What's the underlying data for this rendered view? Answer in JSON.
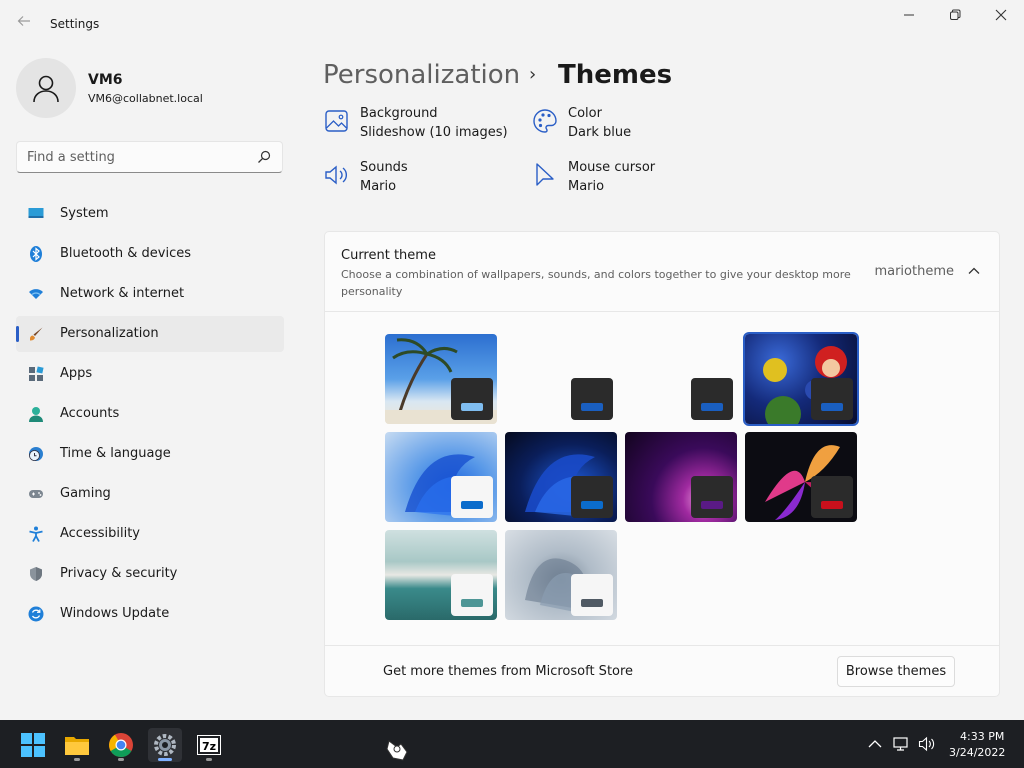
{
  "window": {
    "title": "Settings",
    "back_icon": "arrow-left-icon",
    "minimize_glyph": "—",
    "maximize_glyph": "❐",
    "close_glyph": "✕"
  },
  "profile": {
    "name": "VM6",
    "email": "VM6@collabnet.local"
  },
  "search": {
    "placeholder": "Find a setting"
  },
  "sidebar": {
    "items": [
      {
        "label": "System",
        "icon": "display-icon",
        "active": false
      },
      {
        "label": "Bluetooth & devices",
        "icon": "bluetooth-icon",
        "active": false
      },
      {
        "label": "Network & internet",
        "icon": "wifi-icon",
        "active": false
      },
      {
        "label": "Personalization",
        "icon": "brush-icon",
        "active": true
      },
      {
        "label": "Apps",
        "icon": "apps-icon",
        "active": false
      },
      {
        "label": "Accounts",
        "icon": "person-icon",
        "active": false
      },
      {
        "label": "Time & language",
        "icon": "globe-clock-icon",
        "active": false
      },
      {
        "label": "Gaming",
        "icon": "gamepad-icon",
        "active": false
      },
      {
        "label": "Accessibility",
        "icon": "accessibility-icon",
        "active": false
      },
      {
        "label": "Privacy & security",
        "icon": "shield-icon",
        "active": false
      },
      {
        "label": "Windows Update",
        "icon": "update-icon",
        "active": false
      }
    ]
  },
  "breadcrumb": {
    "parent": "Personalization",
    "separator": "›",
    "current": "Themes"
  },
  "properties": [
    {
      "title": "Background",
      "value": "Slideshow (10 images)",
      "icon": "image-icon"
    },
    {
      "title": "Color",
      "value": "Dark blue",
      "icon": "palette-icon"
    },
    {
      "title": "Sounds",
      "value": "Mario",
      "icon": "speaker-icon"
    },
    {
      "title": "Mouse cursor",
      "value": "Mario",
      "icon": "cursor-icon"
    }
  ],
  "current_theme": {
    "title": "Current theme",
    "description": "Choose a combination of wallpapers, sounds, and colors together to give your desktop more personality",
    "value": "mariotheme",
    "expanded": true
  },
  "themes": [
    {
      "name": "beach",
      "accent": "#7fbdf0",
      "mode": "dark",
      "selected": false
    },
    {
      "name": "blank-1",
      "accent": "#1a5fc0",
      "mode": "dark",
      "selected": false
    },
    {
      "name": "blank-2",
      "accent": "#1a5fc0",
      "mode": "dark",
      "selected": false
    },
    {
      "name": "mario",
      "accent": "#1a5fc0",
      "mode": "dark",
      "selected": true
    },
    {
      "name": "windows-light",
      "accent": "#0b6ccc",
      "mode": "light",
      "selected": false
    },
    {
      "name": "windows-dark",
      "accent": "#0b6ccc",
      "mode": "dark",
      "selected": false
    },
    {
      "name": "glow",
      "accent": "#5a1a86",
      "mode": "dark",
      "selected": false
    },
    {
      "name": "captured-motion",
      "accent": "#c8101c",
      "mode": "dark",
      "selected": false
    },
    {
      "name": "sunrise",
      "accent": "#4e9696",
      "mode": "light",
      "selected": false
    },
    {
      "name": "flow",
      "accent": "#505a64",
      "mode": "light",
      "selected": false
    }
  ],
  "store": {
    "text": "Get more themes from Microsoft Store",
    "button": "Browse themes"
  },
  "taskbar": {
    "apps": [
      "start-icon",
      "file-explorer-icon",
      "chrome-icon",
      "settings-icon",
      "7zip-icon"
    ],
    "seven_zip_label": "7z",
    "time": "4:33 PM",
    "date": "3/24/2022"
  },
  "colors": {
    "accent": "#2a5ec6",
    "background": "#f3f3f3",
    "taskbar": "#1d1f23"
  }
}
